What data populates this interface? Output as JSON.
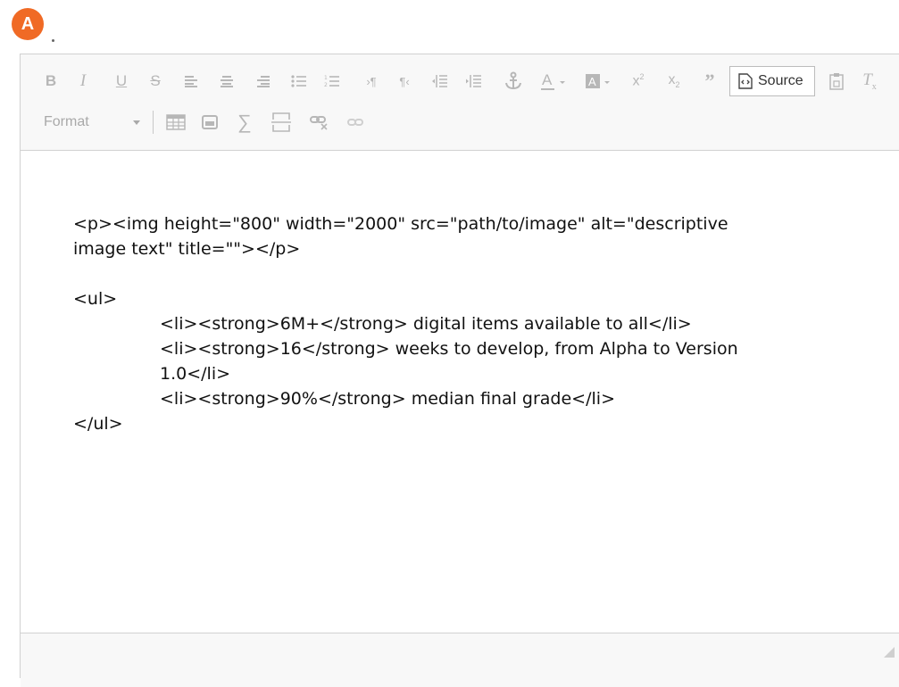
{
  "avatar": {
    "letter": "A",
    "color": "#f06a25"
  },
  "toolbar": {
    "row1": [
      {
        "name": "bold-button",
        "icon": "bold-icon",
        "glyph": "B"
      },
      {
        "name": "italic-button",
        "icon": "italic-icon",
        "glyph": "I"
      },
      {
        "name": "underline-button",
        "icon": "underline-icon",
        "glyph": "U"
      },
      {
        "name": "strikethrough-button",
        "icon": "strikethrough-icon",
        "glyph": "S"
      },
      {
        "name": "align-left-button",
        "icon": "align-left-icon"
      },
      {
        "name": "align-center-button",
        "icon": "align-center-icon"
      },
      {
        "name": "align-right-button",
        "icon": "align-right-icon"
      },
      {
        "name": "bulleted-list-button",
        "icon": "bulleted-list-icon"
      },
      {
        "name": "numbered-list-button",
        "icon": "numbered-list-icon"
      },
      {
        "name": "ltr-button",
        "icon": "ltr-paragraph-icon"
      },
      {
        "name": "rtl-button",
        "icon": "rtl-paragraph-icon"
      },
      {
        "name": "outdent-button",
        "icon": "outdent-icon"
      },
      {
        "name": "indent-button",
        "icon": "indent-icon"
      },
      {
        "name": "anchor-button",
        "icon": "anchor-icon"
      },
      {
        "name": "text-color-button",
        "icon": "text-color-icon"
      },
      {
        "name": "background-color-button",
        "icon": "background-color-icon"
      },
      {
        "name": "superscript-button",
        "icon": "superscript-icon"
      },
      {
        "name": "subscript-button",
        "icon": "subscript-icon"
      },
      {
        "name": "blockquote-button",
        "icon": "blockquote-icon"
      }
    ],
    "source_label": "Source",
    "format_label": "Format"
  },
  "source_lines": {
    "p_line1": "<p><img height=\"800\" width=\"2000\" src=\"path/to/image\" alt=\"descriptive",
    "p_line2": "image text\" title=\"\"></p>",
    "ul_open": "<ul>",
    "li1": "<li><strong>6M+</strong> digital items available to all</li>",
    "li2a": "<li><strong>16</strong> weeks to develop, from Alpha to Version",
    "li2b": "1.0</li>",
    "li3": "<li><strong>90%</strong> median final grade</li>",
    "ul_close": "</ul>"
  },
  "colors": {
    "accent": "#f06a25",
    "toolbar_bg": "#f8f8f8",
    "border": "#d1d1d1",
    "icon_gray": "#b7b7b7"
  }
}
